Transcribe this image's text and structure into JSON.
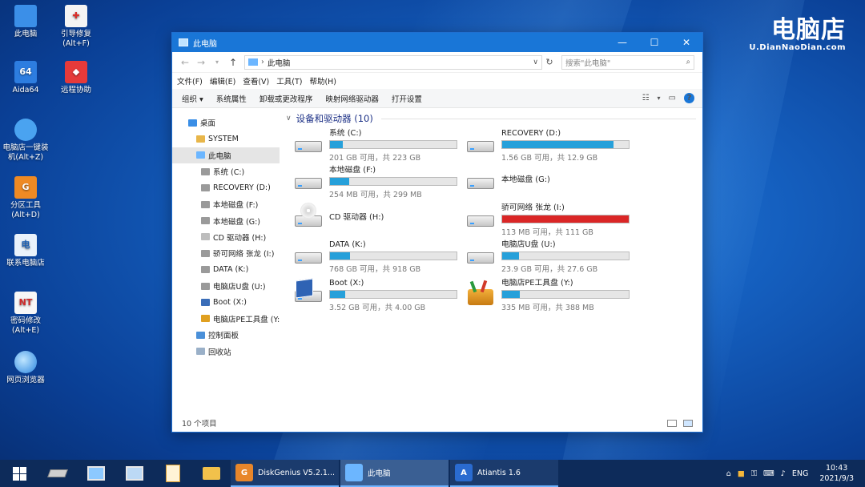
{
  "desktop": {
    "icons": [
      {
        "label": "此电脑",
        "icon": "computer-icon"
      },
      {
        "label": "引导修复\n(Alt+F)",
        "icon": "first-aid-icon"
      },
      {
        "label": "Aida64",
        "icon": "aida64-icon",
        "badge": "64"
      },
      {
        "label": "远程协助",
        "icon": "remote-assist-icon"
      },
      {
        "label": "电脑店一键装\n机(Alt+Z)",
        "icon": "installer-icon"
      },
      {
        "label": "分区工具\n(Alt+D)",
        "icon": "partition-tool-icon",
        "badge": "G"
      },
      {
        "label": "联系电脑店",
        "icon": "contact-icon",
        "badge": "电"
      },
      {
        "label": "密码修改\n(Alt+E)",
        "icon": "password-icon",
        "badge": "NT"
      },
      {
        "label": "网页浏览器",
        "icon": "browser-icon"
      }
    ],
    "brand": {
      "name": "电脑店",
      "url": "U.DianNaoDian.com"
    }
  },
  "window": {
    "title": "此电脑",
    "buttons": {
      "minimize": "—",
      "maximize": "☐",
      "close": "✕"
    },
    "address": {
      "crumb": "此电脑"
    },
    "search": {
      "placeholder": "搜索\"此电脑\""
    },
    "menu": [
      "文件(F)",
      "编辑(E)",
      "查看(V)",
      "工具(T)",
      "帮助(H)"
    ],
    "commands": [
      "组织 ▾",
      "系统属性",
      "卸载或更改程序",
      "映射网络驱动器",
      "打开设置"
    ],
    "tree": [
      {
        "label": "桌面",
        "color": "#3a8ee6",
        "indent": 20
      },
      {
        "label": "SYSTEM",
        "color": "#e8b64a",
        "indent": 30
      },
      {
        "label": "此电脑",
        "color": "#6cb6ff",
        "indent": 30,
        "selected": true
      },
      {
        "label": "系统 (C:)",
        "color": "#9a9a9a",
        "indent": 36
      },
      {
        "label": "RECOVERY (D:)",
        "color": "#9a9a9a",
        "indent": 36
      },
      {
        "label": "本地磁盘 (F:)",
        "color": "#9a9a9a",
        "indent": 36
      },
      {
        "label": "本地磁盘 (G:)",
        "color": "#9a9a9a",
        "indent": 36
      },
      {
        "label": "CD 驱动器 (H:)",
        "color": "#bdbdbd",
        "indent": 36
      },
      {
        "label": "骄可网络 张龙 (I:)",
        "color": "#9a9a9a",
        "indent": 36
      },
      {
        "label": "DATA (K:)",
        "color": "#9a9a9a",
        "indent": 36
      },
      {
        "label": "电脑店U盘 (U:)",
        "color": "#9a9a9a",
        "indent": 36
      },
      {
        "label": "Boot (X:)",
        "color": "#3a6db8",
        "indent": 36
      },
      {
        "label": "电脑店PE工具盘 (Y:)",
        "color": "#e0a020",
        "indent": 36
      },
      {
        "label": "控制面板",
        "color": "#4a90d9",
        "indent": 30
      },
      {
        "label": "回收站",
        "color": "#9ab0c8",
        "indent": 30
      }
    ],
    "group": {
      "title": "设备和驱动器 (10)"
    },
    "drives": [
      {
        "name": "系统 (C:)",
        "size": "201 GB 可用，共 223 GB",
        "used": 0.1,
        "icon": "hdd-icon"
      },
      {
        "name": "RECOVERY (D:)",
        "size": "1.56 GB 可用，共 12.9 GB",
        "used": 0.88,
        "icon": "hdd-icon"
      },
      {
        "name": "本地磁盘 (F:)",
        "size": "254 MB 可用，共 299 MB",
        "used": 0.15,
        "icon": "hdd-icon"
      },
      {
        "name": "本地磁盘 (G:)",
        "size": "",
        "used": null,
        "icon": "hdd-icon"
      },
      {
        "name": "CD 驱动器 (H:)",
        "size": "",
        "used": null,
        "icon": "cd-drive-icon"
      },
      {
        "name": "骄可网络 张龙 (I:)",
        "size": "113 MB 可用，共 111 GB",
        "used": 0.999,
        "red": true,
        "icon": "hdd-icon"
      },
      {
        "name": "DATA (K:)",
        "size": "768 GB 可用，共 918 GB",
        "used": 0.16,
        "icon": "hdd-icon"
      },
      {
        "name": "电脑店U盘 (U:)",
        "size": "23.9 GB 可用，共 27.6 GB",
        "used": 0.13,
        "icon": "hdd-icon"
      },
      {
        "name": "Boot (X:)",
        "size": "3.52 GB 可用，共 4.00 GB",
        "used": 0.12,
        "icon": "boot-drive-icon"
      },
      {
        "name": "电脑店PE工具盘 (Y:)",
        "size": "335 MB 可用，共 388 MB",
        "used": 0.14,
        "icon": "toolbox-icon"
      }
    ],
    "status": "10 个项目"
  },
  "taskbar": {
    "pinned": [
      "start-icon",
      "chip-icon",
      "monitor-icon",
      "computer-settings-icon",
      "search-doc-icon",
      "folder-icon"
    ],
    "apps": [
      {
        "label": "DiskGenius V5.2.1...",
        "icon": "diskgenius-icon",
        "badge": "G",
        "color": "#e8862a"
      },
      {
        "label": "此电脑",
        "icon": "computer-icon",
        "badge": "",
        "color": "#6cb6ff",
        "active": true
      },
      {
        "label": "Atiantis 1.6",
        "icon": "atiantis-icon",
        "badge": "A",
        "color": "#2a6bd0"
      }
    ],
    "tray": {
      "lang": "ENG",
      "time": "10:43",
      "date": "2021/9/3"
    }
  }
}
